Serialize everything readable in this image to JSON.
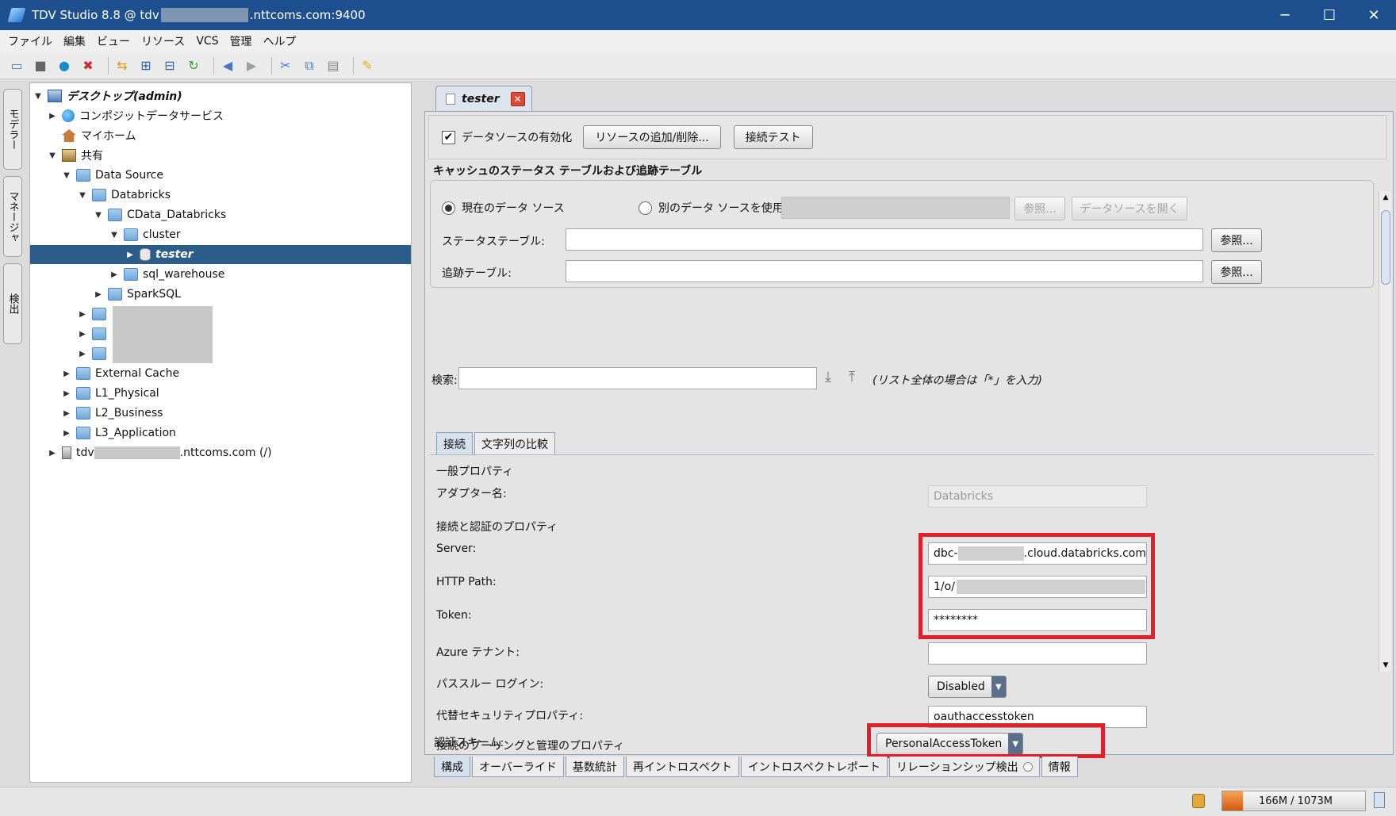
{
  "window": {
    "title_prefix": "TDV Studio 8.8 @ tdv",
    "title_suffix": ".nttcoms.com:9400",
    "minimize": "─",
    "maximize": "☐",
    "close": "✕"
  },
  "menu": [
    "ファイル",
    "編集",
    "ビュー",
    "リソース",
    "VCS",
    "管理",
    "ヘルプ"
  ],
  "dock": {
    "modeler": "モデラー",
    "manager": "マネージャ",
    "discovery": "検出"
  },
  "tree": {
    "rows": [
      {
        "label": "デスクトップ(admin)"
      },
      {
        "label": "コンポジットデータサービス"
      },
      {
        "label": "マイホーム"
      },
      {
        "label": "共有"
      },
      {
        "label": "Data Source"
      },
      {
        "label": "Databricks"
      },
      {
        "label": "CData_Databricks"
      },
      {
        "label": "cluster"
      },
      {
        "label": "tester"
      },
      {
        "label": "sql_warehouse"
      },
      {
        "label": "SparkSQL"
      },
      {
        "label": "External Cache"
      },
      {
        "label": "L1_Physical"
      },
      {
        "label": "L2_Business"
      },
      {
        "label": "L3_Application"
      }
    ],
    "server_prefix": "tdv",
    "server_suffix": ".nttcoms.com (/)"
  },
  "editor": {
    "tab_label": "tester",
    "enable_label": "データソースの有効化",
    "add_remove_btn": "リソースの追加/削除...",
    "test_btn": "接続テスト",
    "cache_title": "キャッシュのステータス テーブルおよび追跡テーブル",
    "current_ds": "現在のデータ ソース",
    "other_ds": "別のデータ ソースを使用",
    "browse_btn": "参照...",
    "open_ds_btn": "データソースを開く",
    "status_table": "ステータステーブル:",
    "tracking_table": "追跡テーブル:",
    "search_label": "検索:",
    "search_hint": "(リスト全体の場合は「*」を入力)",
    "subtabs": [
      "接続",
      "文字列の比較"
    ],
    "props": {
      "general": "一般プロパティ",
      "adapter_label": "アダプター名:",
      "adapter_value": "Databricks",
      "conn_auth": "接続と認証のプロパティ",
      "server_label": "Server:",
      "server_prefix": "dbc-",
      "server_suffix": ".cloud.databricks.com",
      "http_label": "HTTP Path:",
      "http_prefix": "1/o/",
      "token_label": "Token:",
      "token_value": "********",
      "azure_label": "Azure テナント:",
      "azure_value": "",
      "passthrough_label": "パススルー ログイン:",
      "passthrough_value": "Disabled",
      "alt_sec_label": "代替セキュリティプロパティ:",
      "alt_sec_value": "oauthaccesstoken",
      "pooling": "接続のプーリングと管理のプロパティ",
      "auth_scheme_label": "認証スキーム:",
      "auth_scheme_value": "PersonalAccessToken"
    },
    "bottom_tabs": [
      "構成",
      "オーバーライド",
      "基数統計",
      "再イントロスペクト",
      "イントロスペクトレポート",
      "リレーションシップ検出",
      "情報"
    ]
  },
  "status": {
    "memory": "166M / 1073M",
    "memory_fraction": 0.155
  },
  "colors": {
    "title_bar": "#1e4f8e",
    "selection": "#2c5d8a",
    "highlight": "#e0202c"
  }
}
